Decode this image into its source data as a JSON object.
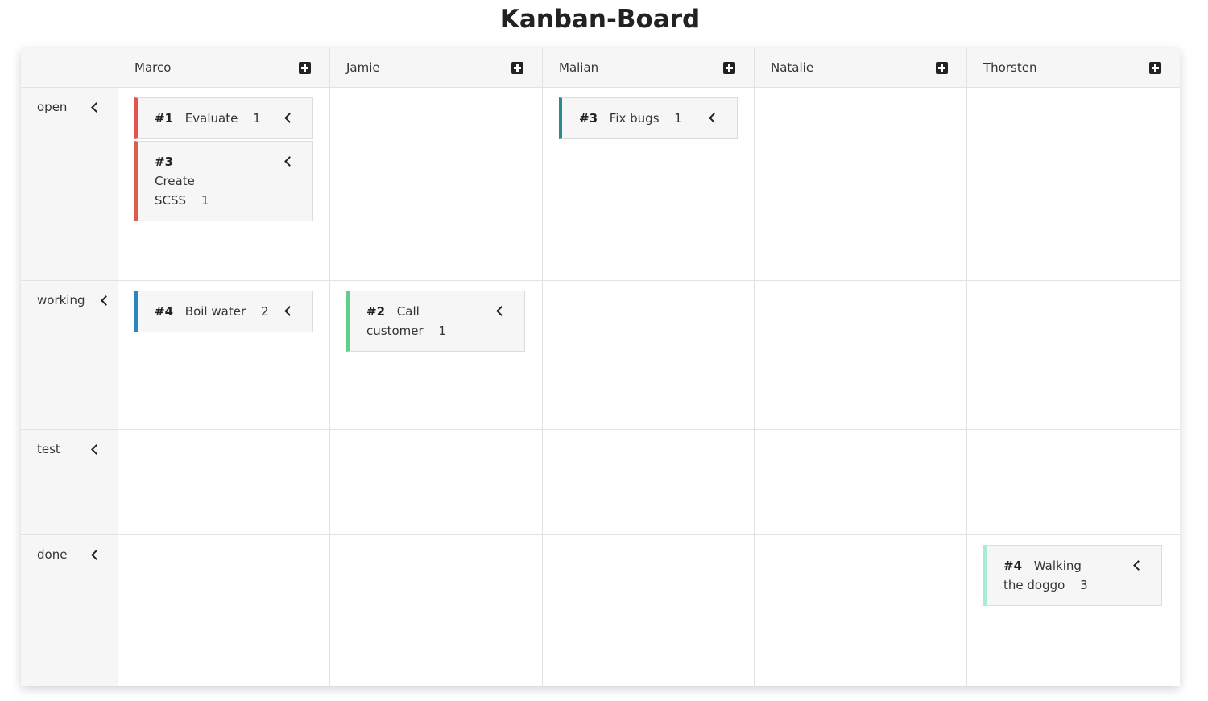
{
  "title": "Kanban-Board",
  "users": [
    "Marco",
    "Jamie",
    "Malian",
    "Natalie",
    "Thorsten"
  ],
  "statuses": [
    "open",
    "working",
    "test",
    "done"
  ],
  "cards": {
    "c1": {
      "num": "#1",
      "title": "Evaluate",
      "points": "1",
      "color": "#e45351"
    },
    "c2": {
      "num": "#3",
      "title": "Create SCSS",
      "points": "1",
      "color": "#d9604a"
    },
    "c3": {
      "num": "#3",
      "title": "Fix bugs",
      "points": "1",
      "color": "#2b8a8e"
    },
    "c4": {
      "num": "#4",
      "title": "Boil water",
      "points": "2",
      "color": "#2c86bb"
    },
    "c5": {
      "num": "#2",
      "title": "Call customer",
      "points": "1",
      "color": "#5fcf8a"
    },
    "c6": {
      "num": "#4",
      "title": "Walking the doggo",
      "points": "3",
      "color": "#a6ecd6"
    }
  },
  "icons": {
    "add": "plus-square-icon",
    "move": "chevron-left-icon"
  }
}
